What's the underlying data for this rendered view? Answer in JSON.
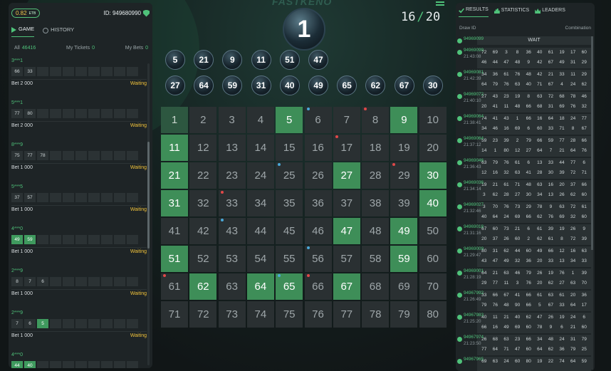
{
  "header": {
    "balance": "0.82",
    "currency": "ETB",
    "user_id": "ID: 949680990"
  },
  "left_tabs": {
    "game": "GAME",
    "history": "HISTORY"
  },
  "filters": {
    "all_label": "All",
    "all_count": "46416",
    "my_tickets_label": "My Tickets",
    "my_tickets_count": "0",
    "my_bets_label": "My Bets",
    "my_bets_count": "0"
  },
  "tickets": [
    {
      "user": "3***1",
      "numbers": [
        "66",
        "33"
      ],
      "hits": [],
      "bet": "Bet 2 000",
      "status": "Waiting"
    },
    {
      "user": "5***1",
      "numbers": [
        "77",
        "80"
      ],
      "hits": [],
      "bet": "Bet 2 000",
      "status": "Waiting"
    },
    {
      "user": "8***9",
      "numbers": [
        "75",
        "77",
        "78"
      ],
      "hits": [],
      "bet": "Bet 1 000",
      "status": "Waiting"
    },
    {
      "user": "5***5",
      "numbers": [
        "37",
        "57"
      ],
      "hits": [],
      "bet": "Bet 1 000",
      "status": "Waiting"
    },
    {
      "user": "4***0",
      "numbers": [
        "49",
        "59"
      ],
      "hits": [
        0,
        1
      ],
      "bet": "Bet 1 000",
      "status": "Waiting"
    },
    {
      "user": "2***9",
      "numbers": [
        "8",
        "7",
        "6"
      ],
      "hits": [],
      "bet": "Bet 1 000",
      "status": "Waiting"
    },
    {
      "user": "2***9",
      "numbers": [
        "7",
        "6",
        "5"
      ],
      "hits": [
        2
      ],
      "bet": "Bet 1 000",
      "status": "Waiting"
    },
    {
      "user": "4***0",
      "numbers": [
        "44",
        "40"
      ],
      "hits": [
        0,
        1
      ],
      "bet": "",
      "status": ""
    }
  ],
  "game": {
    "logo": "FASTKENO",
    "current_ball": "1",
    "drawn_count": "16",
    "total_draws": "20",
    "drawn_balls": [
      "5",
      "21",
      "9",
      "11",
      "51",
      "47",
      "27",
      "64",
      "59",
      "31",
      "40",
      "49",
      "65",
      "62",
      "67",
      "30"
    ],
    "board_selected": [
      5,
      9,
      11,
      21,
      27,
      30,
      31,
      40,
      47,
      49,
      51,
      59,
      62,
      64,
      65,
      67
    ],
    "board_first": [
      1
    ],
    "board_dots": [
      {
        "n": 6,
        "color": "#4aa8d8"
      },
      {
        "n": 8,
        "color": "#e04848"
      },
      {
        "n": 17,
        "color": "#e04848"
      },
      {
        "n": 25,
        "color": "#4aa8d8"
      },
      {
        "n": 29,
        "color": "#e04848"
      },
      {
        "n": 33,
        "color": "#e04848"
      },
      {
        "n": 43,
        "color": "#4aa8d8"
      },
      {
        "n": 56,
        "color": "#4aa8d8"
      },
      {
        "n": 61,
        "color": "#e04848"
      },
      {
        "n": 65,
        "color": "#4aa8d8"
      },
      {
        "n": 66,
        "color": "#e04848"
      }
    ]
  },
  "right_tabs": {
    "results": "RESULTS",
    "statistics": "STATISTICS",
    "leaders": "LEADERS"
  },
  "results_header": {
    "draw_id": "Draw ID",
    "combination": "Combination"
  },
  "results": [
    {
      "id": "94969099",
      "time": "",
      "waiting": "WAIT",
      "nums": []
    },
    {
      "id": "94969099",
      "time": "21:43:08",
      "nums": [
        "72",
        "69",
        "3",
        "8",
        "36",
        "40",
        "61",
        "19",
        "17",
        "60",
        "46",
        "44",
        "47",
        "48",
        "9",
        "42",
        "67",
        "49",
        "31",
        "29"
      ]
    },
    {
      "id": "94969081",
      "time": "21:42:39",
      "nums": [
        "34",
        "36",
        "61",
        "76",
        "48",
        "42",
        "21",
        "33",
        "11",
        "29",
        "64",
        "79",
        "76",
        "63",
        "40",
        "71",
        "67",
        "4",
        "24",
        "62"
      ]
    },
    {
      "id": "94969072",
      "time": "21:40:10",
      "nums": [
        "27",
        "43",
        "23",
        "19",
        "8",
        "63",
        "72",
        "68",
        "78",
        "46",
        "20",
        "41",
        "11",
        "48",
        "66",
        "68",
        "31",
        "69",
        "76",
        "32"
      ]
    },
    {
      "id": "94969064",
      "time": "21:38:41",
      "nums": [
        "74",
        "41",
        "43",
        "1",
        "66",
        "16",
        "64",
        "18",
        "24",
        "77",
        "34",
        "46",
        "16",
        "69",
        "6",
        "60",
        "33",
        "71",
        "8",
        "67"
      ]
    },
    {
      "id": "94969064",
      "time": "21:37:12",
      "nums": [
        "59",
        "23",
        "39",
        "2",
        "79",
        "66",
        "59",
        "77",
        "28",
        "66",
        "14",
        "1",
        "80",
        "12",
        "27",
        "64",
        "7",
        "21",
        "64",
        "76"
      ]
    },
    {
      "id": "94969046",
      "time": "21:36:43",
      "nums": [
        "63",
        "79",
        "76",
        "61",
        "6",
        "13",
        "33",
        "44",
        "77",
        "6",
        "12",
        "16",
        "32",
        "63",
        "41",
        "28",
        "30",
        "39",
        "72",
        "71"
      ]
    },
    {
      "id": "94969036",
      "time": "21:34:14",
      "nums": [
        "19",
        "21",
        "61",
        "71",
        "48",
        "63",
        "16",
        "20",
        "37",
        "66",
        "3",
        "62",
        "28",
        "27",
        "30",
        "34",
        "13",
        "26",
        "62",
        "60"
      ]
    },
    {
      "id": "94969027",
      "time": "21:32:46",
      "nums": [
        "3",
        "70",
        "76",
        "73",
        "29",
        "78",
        "9",
        "63",
        "72",
        "61",
        "40",
        "64",
        "24",
        "69",
        "66",
        "62",
        "76",
        "69",
        "32",
        "60"
      ]
    },
    {
      "id": "94969018",
      "time": "21:31:16",
      "nums": [
        "67",
        "60",
        "73",
        "21",
        "6",
        "61",
        "39",
        "19",
        "26",
        "9",
        "20",
        "37",
        "26",
        "60",
        "2",
        "62",
        "61",
        "8",
        "72",
        "39"
      ]
    },
    {
      "id": "94969009",
      "time": "21:29:47",
      "nums": [
        "80",
        "31",
        "62",
        "44",
        "60",
        "49",
        "66",
        "12",
        "16",
        "63",
        "43",
        "47",
        "49",
        "32",
        "36",
        "20",
        "33",
        "13",
        "34",
        "33"
      ]
    },
    {
      "id": "94969001",
      "time": "21:28:19",
      "nums": [
        "64",
        "21",
        "63",
        "46",
        "79",
        "26",
        "19",
        "76",
        "1",
        "39",
        "29",
        "77",
        "11",
        "3",
        "76",
        "20",
        "62",
        "27",
        "63",
        "70"
      ]
    },
    {
      "id": "94967992",
      "time": "21:26:49",
      "nums": [
        "33",
        "66",
        "67",
        "41",
        "66",
        "61",
        "63",
        "61",
        "20",
        "36",
        "79",
        "76",
        "48",
        "90",
        "66",
        "5",
        "67",
        "33",
        "64",
        "17"
      ]
    },
    {
      "id": "94967983",
      "time": "21:25:20",
      "nums": [
        "40",
        "11",
        "21",
        "40",
        "62",
        "47",
        "26",
        "19",
        "24",
        "6",
        "66",
        "16",
        "49",
        "69",
        "60",
        "78",
        "9",
        "6",
        "21",
        "60"
      ]
    },
    {
      "id": "94967974",
      "time": "21:23:50",
      "nums": [
        "26",
        "68",
        "63",
        "23",
        "66",
        "34",
        "48",
        "24",
        "31",
        "79",
        "77",
        "64",
        "71",
        "47",
        "60",
        "64",
        "62",
        "36",
        "79",
        "25"
      ]
    },
    {
      "id": "94967965",
      "time": "",
      "nums": [
        "69",
        "63",
        "24",
        "60",
        "80",
        "19",
        "22",
        "74",
        "64",
        "59"
      ]
    }
  ]
}
